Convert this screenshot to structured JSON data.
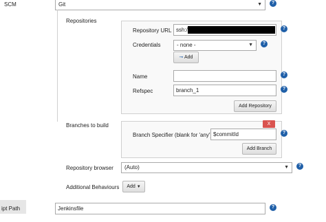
{
  "scm": {
    "label": "SCM",
    "value": "Git"
  },
  "repositories": {
    "label": "Repositories",
    "url_label": "Repository URL",
    "url_value": "ssh://",
    "credentials_label": "Credentials",
    "credentials_value": "- none -",
    "add_credentials_label": "Add",
    "name_label": "Name",
    "name_value": "",
    "refspec_label": "Refspec",
    "refspec_value": "branch_1",
    "add_repository_label": "Add Repository"
  },
  "branches": {
    "label": "Branches to build",
    "delete_label": "X",
    "specifier_label": "Branch Specifier (blank for 'any')",
    "specifier_value": "$commitId",
    "add_branch_label": "Add Branch"
  },
  "repository_browser": {
    "label": "Repository browser",
    "value": "(Auto)"
  },
  "additional_behaviours": {
    "label": "Additional Behaviours",
    "add_label": "Add"
  },
  "script_path": {
    "label": "ipt Path",
    "value": "Jenkinsfile"
  },
  "help_glyph": "?",
  "colors": {
    "help": "#1f5fa8",
    "delete": "#d9534f",
    "panel_bg": "#f9f9f9"
  }
}
